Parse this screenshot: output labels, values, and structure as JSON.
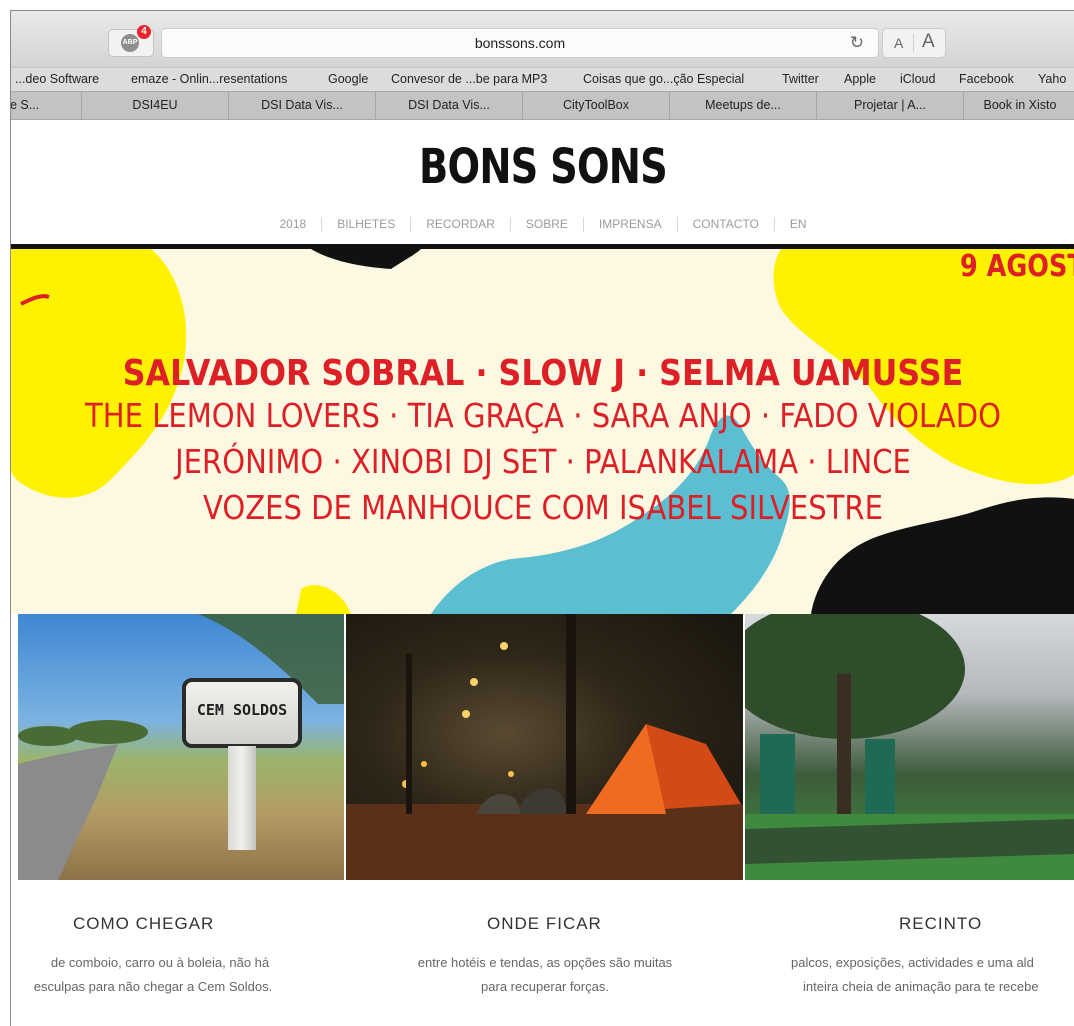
{
  "browser": {
    "abp_label": "ABP",
    "abp_badge": "4",
    "url": "bonssons.com",
    "reload_icon": "↻",
    "font_small": "A",
    "font_large": "A"
  },
  "bookmarks": [
    "...deo Software",
    "emaze - Onlin...resentations",
    "Google",
    "Convesor de ...be para MP3",
    "Coisas que go...ção Especial",
    "Twitter",
    "Apple",
    "iCloud",
    "Facebook",
    "Yaho"
  ],
  "tabs": [
    "e S...",
    "DSI4EU",
    "DSI Data Vis...",
    "DSI Data Vis...",
    "CityToolBox",
    "Meetups de...",
    "Projetar  |  A...",
    "Book in Xisto"
  ],
  "site": {
    "logo": "BONS SONS",
    "nav": [
      "2018",
      "BILHETES",
      "RECORDAR",
      "SOBRE",
      "IMPRENSA",
      "CONTACTO",
      "EN"
    ]
  },
  "hero": {
    "date": "9 AGOST",
    "lineup": [
      "SALVADOR SOBRAL · SLOW J · SELMA UAMUSSE",
      "THE LEMON LOVERS · TIA GRAÇA · SARA ANJO · FADO VIOLADO",
      "JERÓNIMO · XINOBI DJ SET · PALANKALAMA · LINCE",
      "VOZES DE MANHOUCE COM ISABEL SILVESTRE"
    ]
  },
  "photos": {
    "sign_text": "CEM SOLDOS"
  },
  "columns": [
    {
      "title": "COMO CHEGAR",
      "desc_line1": "de comboio, carro ou à boleia, não há",
      "desc_line2": "esculpas para não chegar a Cem Soldos."
    },
    {
      "title": "ONDE FICAR",
      "desc_line1": "entre hotéis e tendas, as opções são muitas",
      "desc_line2": "para recuperar forças."
    },
    {
      "title": "RECINTO",
      "desc_line1": "palcos, exposições, actividades e uma ald",
      "desc_line2": "inteira cheia de animação para te recebe"
    }
  ],
  "colors": {
    "accent_red": "#dd1f26",
    "hero_yellow": "#fff200",
    "hero_cream": "#fdf8e2",
    "hero_blue": "#5bbfd1"
  }
}
